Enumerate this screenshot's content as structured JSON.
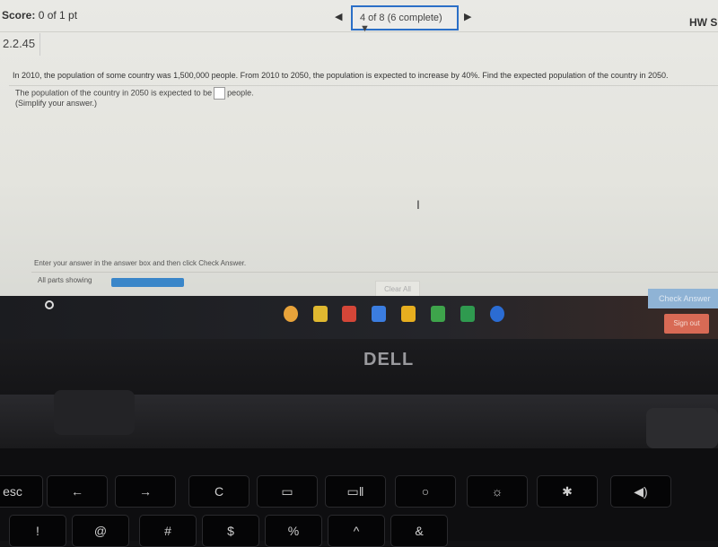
{
  "header": {
    "score_label": "Score:",
    "score_value": "0 of 1 pt",
    "question_selector": "4 of 8 (6 complete)",
    "prev_icon": "triangle-left",
    "next_icon": "triangle-right",
    "hw_label": "HW S"
  },
  "problem": {
    "number": "2.2.45",
    "question": "In 2010, the population of some country was 1,500,000 people. From 2010 to 2050, the population is expected to increase by 40%. Find the expected population of the country in 2050.",
    "answer_prefix": "The population of the country in 2050 is expected to be",
    "answer_value": "",
    "answer_suffix": "people.",
    "hint": "(Simplify your answer.)"
  },
  "footer": {
    "instruction": "Enter your answer in the answer box and then click Check Answer.",
    "parts_label": "All parts showing",
    "parts_progress": 1.0,
    "clear_all": "Clear All",
    "check_answer": "Check Answer"
  },
  "shelf": {
    "apps": [
      {
        "name": "chrome",
        "color": "#e8a33a"
      },
      {
        "name": "classroom",
        "color": "#e0b830"
      },
      {
        "name": "gmail",
        "color": "#d44638"
      },
      {
        "name": "docs",
        "color": "#3b7de0"
      },
      {
        "name": "slides",
        "color": "#e7ae1f"
      },
      {
        "name": "drive",
        "color": "#3ea44b"
      },
      {
        "name": "sheets",
        "color": "#2f9a4f"
      },
      {
        "name": "files",
        "color": "#2b6cd3"
      }
    ],
    "sign_out": "Sign out"
  },
  "laptop": {
    "brand": "DELL"
  },
  "keyboard": {
    "top_row": [
      "esc",
      "←",
      "→",
      "C",
      "▭",
      "▭ǁ",
      "○",
      "☼",
      "✱",
      "◀)"
    ],
    "bottom_row": [
      "!",
      "@",
      "#",
      "$",
      "%",
      "^",
      "&"
    ]
  }
}
